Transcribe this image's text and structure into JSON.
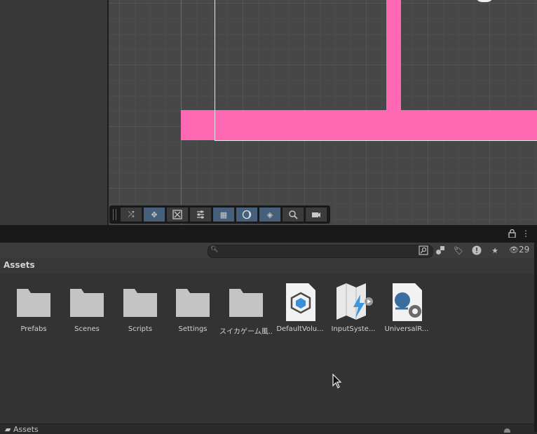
{
  "project": {
    "search": {
      "placeholder": "",
      "value": ""
    },
    "visible_count": "29",
    "breadcrumb": "Assets",
    "bottom_path": "Assets",
    "assets": [
      {
        "label": "Prefabs",
        "kind": "folder"
      },
      {
        "label": "Scenes",
        "kind": "folder"
      },
      {
        "label": "Scripts",
        "kind": "folder"
      },
      {
        "label": "Settings",
        "kind": "folder"
      },
      {
        "label": "スイカゲーム風...",
        "kind": "folder"
      },
      {
        "label": "DefaultVolu...",
        "kind": "volume-profile"
      },
      {
        "label": "InputSyste...",
        "kind": "input-actions"
      },
      {
        "label": "UniversalR...",
        "kind": "render-pipeline-asset"
      }
    ]
  },
  "scene_toolbar": {
    "buttons": [
      {
        "icon": "shuffle-icon",
        "active": false
      },
      {
        "icon": "move-icon",
        "active": true
      },
      {
        "icon": "scale-icon",
        "active": false
      },
      {
        "icon": "sliders-icon",
        "active": false
      },
      {
        "icon": "grid-snap-icon",
        "active": true
      },
      {
        "icon": "moon-icon",
        "active": true
      },
      {
        "icon": "layers-icon",
        "active": true
      },
      {
        "icon": "search-icon",
        "active": false
      },
      {
        "icon": "camera-icon",
        "active": false
      }
    ]
  },
  "colors": {
    "accent_pink": "#ff69b4",
    "active_button": "#46607c",
    "panel": "#383838"
  }
}
